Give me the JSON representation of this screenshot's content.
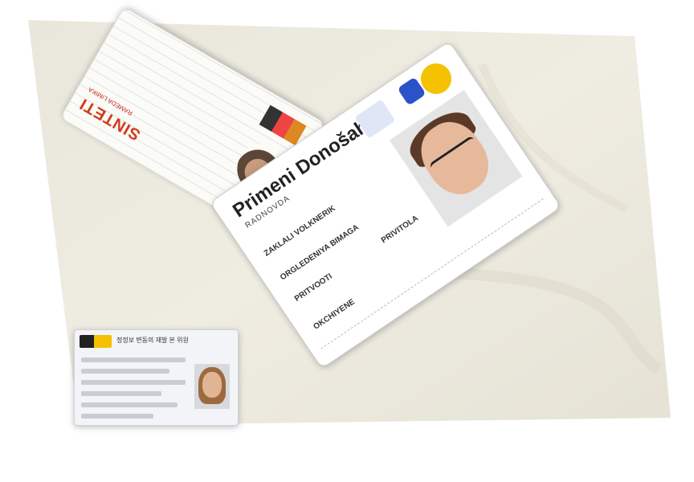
{
  "scene": {
    "background_color": "#ece9dc"
  },
  "card_main": {
    "title": "Primeni Donošahu",
    "subtitle": "RADNOVDA",
    "fields": [
      "ZAKLALI VOLKNERIK",
      "ORGLEDENIYA BIMAGA",
      "PRITVOOTI",
      "PRIVITOLA",
      "OKCHIYENE"
    ]
  },
  "card_back": {
    "brand": "SINTETI",
    "subtitle": "RAMEDA LIMIKA"
  },
  "card_small": {
    "header": "정정보 변동의 재발 본 위원"
  }
}
